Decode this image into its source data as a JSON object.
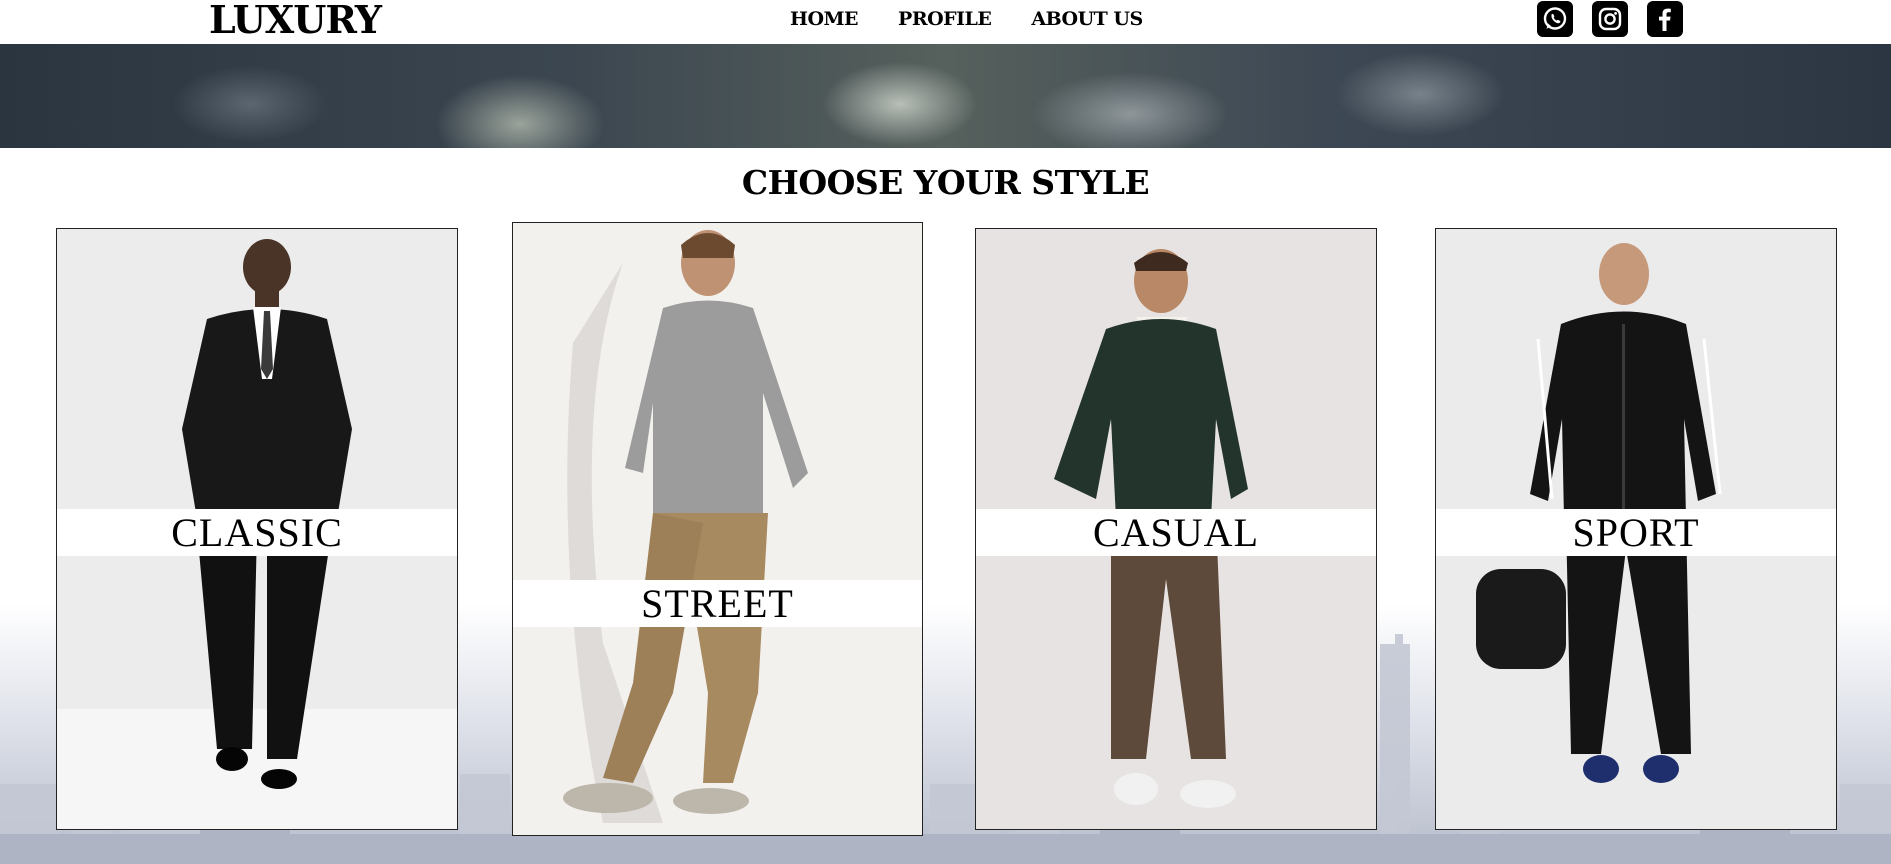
{
  "brand": {
    "logo": "LUXURY"
  },
  "nav": [
    {
      "label": "HOME"
    },
    {
      "label": "PROFILE"
    },
    {
      "label": "ABOUT US"
    }
  ],
  "socials": [
    {
      "icon": "whatsapp-icon"
    },
    {
      "icon": "instagram-icon"
    },
    {
      "icon": "facebook-icon"
    }
  ],
  "section": {
    "title": "CHOOSE YOUR STYLE"
  },
  "styles": [
    {
      "label": "CLASSIC",
      "bg": "#e9e9e9",
      "top_color": "#1a1a1a",
      "bottom_color": "#111111",
      "shirt": "#ffffff"
    },
    {
      "label": "STREET",
      "bg": "#f1efec",
      "top_color": "#9a9a9a",
      "bottom_color": "#a88a60",
      "shirt": "#9a9a9a"
    },
    {
      "label": "CASUAL",
      "bg": "#e6e2e1",
      "top_color": "#22342b",
      "bottom_color": "#5e4a3a",
      "shirt": "#ffffff"
    },
    {
      "label": "SPORT",
      "bg": "#eaeaea",
      "top_color": "#141414",
      "bottom_color": "#141414",
      "shirt": "#141414"
    }
  ],
  "colors": {
    "accent": "#000000",
    "band": "#ffffff"
  }
}
